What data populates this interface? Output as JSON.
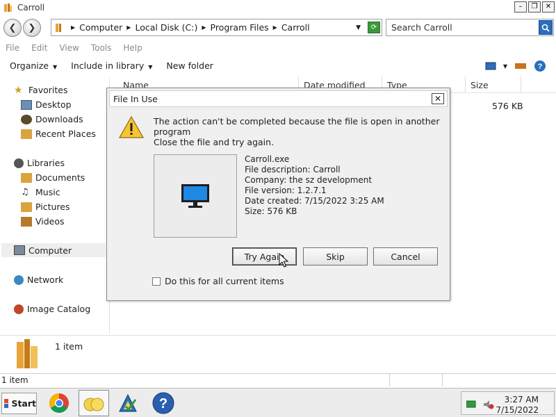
{
  "window": {
    "title": "Carroll"
  },
  "address": {
    "crumbs": [
      "Computer",
      "Local Disk (C:)",
      "Program Files",
      "Carroll"
    ],
    "search_placeholder": "Search Carroll"
  },
  "menu": [
    "File",
    "Edit",
    "View",
    "Tools",
    "Help"
  ],
  "commands": {
    "organize": "Organize",
    "include": "Include in library",
    "new_folder": "New folder"
  },
  "nav": {
    "favorites": "Favorites",
    "desktop": "Desktop",
    "downloads": "Downloads",
    "recent": "Recent Places",
    "libraries": "Libraries",
    "documents": "Documents",
    "music": "Music",
    "pictures": "Pictures",
    "videos": "Videos",
    "computer": "Computer",
    "network": "Network",
    "image_catalog": "Image Catalog"
  },
  "columns": [
    "Name",
    "Date modified",
    "Type",
    "Size"
  ],
  "file_row": {
    "size": "576 KB"
  },
  "details": {
    "count": "1 item"
  },
  "status": {
    "count": "1 item"
  },
  "taskbar": {
    "start": "Start",
    "time": "3:27 AM",
    "date": "7/15/2022"
  },
  "dialog": {
    "title": "File In Use",
    "message": "The action can't be completed because the file is open in another program",
    "instruction": "Close the file and try again.",
    "file_name": "Carroll.exe",
    "description": "File description: Carroll",
    "company": "Company: the sz development",
    "version": "File version: 1.2.7.1",
    "created": "Date created: 7/15/2022 3:25 AM",
    "size": "Size: 576 KB",
    "btn_try_again": "Try Again",
    "btn_skip": "Skip",
    "btn_cancel": "Cancel",
    "checkbox_label": "Do this for all current items"
  },
  "colors": {
    "accent": "#2a6ebd",
    "monitor_blue": "#1e88e5"
  }
}
